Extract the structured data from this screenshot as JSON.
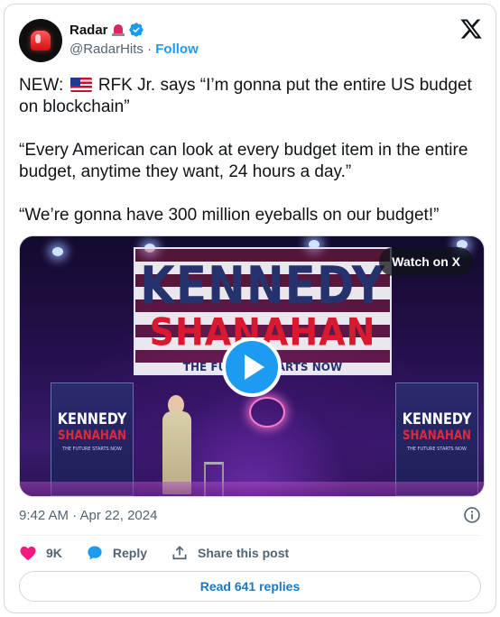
{
  "author": {
    "display_name": "Radar",
    "handle": "@RadarHits",
    "separator": "·",
    "follow_label": "Follow"
  },
  "tweet": {
    "line1_prefix": "NEW:",
    "line1_rest": "RFK Jr. says “I’m gonna put the entire US budget on blockchain”",
    "line2": "“Every American can look at every budget item in the entire budget, anytime they want, 24 hours a day.”",
    "line3": "“We’re gonna have 300 million eyeballs on our budget!”"
  },
  "media": {
    "watch_label": "Watch on X",
    "banner_line1": "KENNEDY",
    "banner_line2": "SHANAHAN",
    "banner_line3": "THE FUTURE STARTS NOW",
    "sign_line1": "KENNEDY",
    "sign_line2": "SHANAHAN",
    "sign_line3": "THE FUTURE STARTS NOW"
  },
  "meta": {
    "timestamp": "9:42 AM · Apr 22, 2024"
  },
  "actions": {
    "likes_count": "9K",
    "reply_label": "Reply",
    "share_label": "Share this post"
  },
  "footer": {
    "read_replies_label": "Read 641 replies"
  },
  "colors": {
    "accent": "#1d9bf0",
    "like": "#f91880",
    "secondary_text": "#536471"
  }
}
